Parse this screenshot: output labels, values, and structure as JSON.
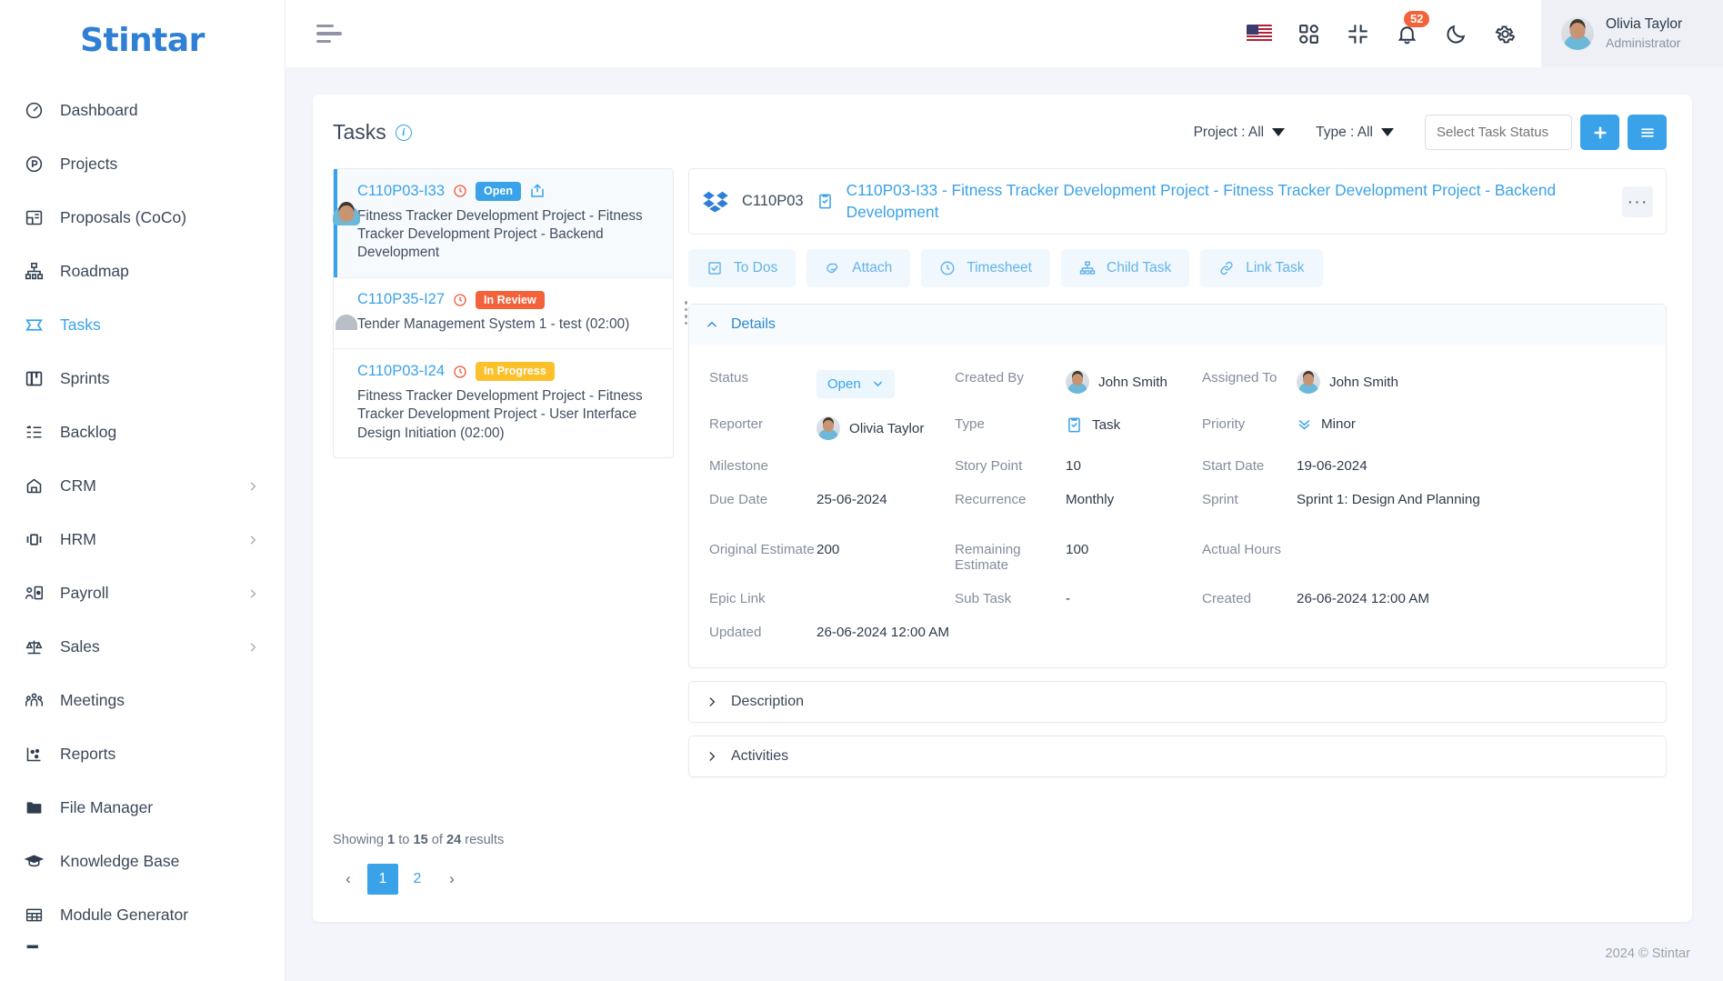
{
  "brand": {
    "name": "Stintar"
  },
  "sidebar": {
    "items": [
      {
        "label": "Dashboard",
        "icon": "gauge-icon",
        "active": false,
        "expandable": false
      },
      {
        "label": "Projects",
        "icon": "project-circle-icon",
        "active": false,
        "expandable": false
      },
      {
        "label": "Proposals (CoCo)",
        "icon": "proposal-icon",
        "active": false,
        "expandable": false
      },
      {
        "label": "Roadmap",
        "icon": "roadmap-icon",
        "active": false,
        "expandable": false
      },
      {
        "label": "Tasks",
        "icon": "tasks-icon",
        "active": true,
        "expandable": false
      },
      {
        "label": "Sprints",
        "icon": "sprints-board-icon",
        "active": false,
        "expandable": false
      },
      {
        "label": "Backlog",
        "icon": "backlog-list-icon",
        "active": false,
        "expandable": false
      },
      {
        "label": "CRM",
        "icon": "crm-icon",
        "active": false,
        "expandable": true
      },
      {
        "label": "HRM",
        "icon": "hrm-icon",
        "active": false,
        "expandable": true
      },
      {
        "label": "Payroll",
        "icon": "payroll-icon",
        "active": false,
        "expandable": true
      },
      {
        "label": "Sales",
        "icon": "sales-scale-icon",
        "active": false,
        "expandable": true
      },
      {
        "label": "Meetings",
        "icon": "meetings-people-icon",
        "active": false,
        "expandable": false
      },
      {
        "label": "Reports",
        "icon": "reports-chart-icon",
        "active": false,
        "expandable": false
      },
      {
        "label": "File Manager",
        "icon": "folder-icon",
        "active": false,
        "expandable": false
      },
      {
        "label": "Knowledge Base",
        "icon": "graduation-cap-icon",
        "active": false,
        "expandable": false
      },
      {
        "label": "Module Generator",
        "icon": "grid-table-icon",
        "active": false,
        "expandable": false
      }
    ]
  },
  "topbar": {
    "menu_toggle": "hamburger-icon",
    "language_flag": "us-flag-icon",
    "apps_icon": "apps-grid-icon",
    "fullscreen_icon": "collapse-screen-icon",
    "notifications_icon": "bell-icon",
    "notifications_count": "52",
    "dark_mode_icon": "moon-icon",
    "settings_icon": "gear-icon",
    "user": {
      "name": "Olivia Taylor",
      "role": "Administrator"
    }
  },
  "tasks_page": {
    "title": "Tasks",
    "info_icon": "info-icon",
    "filters": [
      {
        "label": "Project : All"
      },
      {
        "label": "Type : All"
      }
    ],
    "status_select_placeholder": "Select Task Status",
    "add_button": "plus-icon",
    "list_button": "list-icon",
    "list": [
      {
        "key": "C110P03-I33",
        "status_label": "Open",
        "status_kind": "open",
        "description": "Fitness Tracker Development Project - Fitness Tracker Development Project - Backend Development",
        "has_share": true,
        "avatar": "photo",
        "selected": true
      },
      {
        "key": "C110P35-I27",
        "status_label": "In Review",
        "status_kind": "review",
        "description": "Tender Management System 1 - test (02:00)",
        "has_share": false,
        "avatar": "person",
        "selected": false
      },
      {
        "key": "C110P03-I24",
        "status_label": "In Progress",
        "status_kind": "progress",
        "description": "Fitness Tracker Development Project - Fitness Tracker Development Project - User Interface Design Initiation (02:00)",
        "has_share": false,
        "avatar": "photo2",
        "selected": false
      }
    ],
    "results_prefix": "Showing",
    "results_from": "1",
    "results_mid": "to",
    "results_to": "15",
    "results_of": "of",
    "results_total": "24",
    "results_suffix": "results",
    "pagination": {
      "prev": "‹",
      "pages": [
        "1",
        "2"
      ],
      "current": "1",
      "next": "›"
    }
  },
  "detail": {
    "project_key": "C110P03",
    "project_icon": "dropbox-icon",
    "type_icon": "task-clipboard-icon",
    "title": "C110P03-I33 - Fitness Tracker Development Project - Fitness Tracker Development Project - Backend Development",
    "more_button": "ellipsis-icon",
    "tabs": [
      {
        "label": "To Dos",
        "icon": "checkbox-icon"
      },
      {
        "label": "Attach",
        "icon": "paperclip-icon"
      },
      {
        "label": "Timesheet",
        "icon": "clock-icon"
      },
      {
        "label": "Child Task",
        "icon": "hierarchy-icon"
      },
      {
        "label": "Link Task",
        "icon": "link-icon"
      }
    ],
    "sections": {
      "details": {
        "label": "Details",
        "expanded": true
      },
      "description": {
        "label": "Description",
        "expanded": false
      },
      "activities": {
        "label": "Activities",
        "expanded": false
      }
    },
    "fields": {
      "status": {
        "label": "Status",
        "value": "Open"
      },
      "created_by": {
        "label": "Created By",
        "value": "John Smith"
      },
      "assigned_to": {
        "label": "Assigned To",
        "value": "John Smith"
      },
      "reporter": {
        "label": "Reporter",
        "value": "Olivia Taylor"
      },
      "type": {
        "label": "Type",
        "value": "Task"
      },
      "priority": {
        "label": "Priority",
        "value": "Minor"
      },
      "milestone": {
        "label": "Milestone",
        "value": ""
      },
      "story_point": {
        "label": "Story Point",
        "value": "10"
      },
      "start_date": {
        "label": "Start Date",
        "value": "19-06-2024"
      },
      "due_date": {
        "label": "Due Date",
        "value": "25-06-2024"
      },
      "recurrence": {
        "label": "Recurrence",
        "value": "Monthly"
      },
      "sprint": {
        "label": "Sprint",
        "value": "Sprint 1: Design And Planning"
      },
      "original_estimate": {
        "label": "Original Estimate",
        "value": "200"
      },
      "remaining_estimate": {
        "label": "Remaining Estimate",
        "value": "100"
      },
      "actual_hours": {
        "label": "Actual Hours",
        "value": ""
      },
      "epic_link": {
        "label": "Epic Link",
        "value": ""
      },
      "sub_task": {
        "label": "Sub Task",
        "value": "-"
      },
      "created": {
        "label": "Created",
        "value": "26-06-2024 12:00 AM"
      },
      "updated": {
        "label": "Updated",
        "value": "26-06-2024 12:00 AM"
      }
    }
  },
  "footer": {
    "copyright": "2024 © Stintar"
  },
  "colors": {
    "accent": "#3aa2e8",
    "brand": "#2f7fd4",
    "danger": "#f4623a",
    "warning": "#fcc02b",
    "page_bg": "#f4f5fa"
  }
}
